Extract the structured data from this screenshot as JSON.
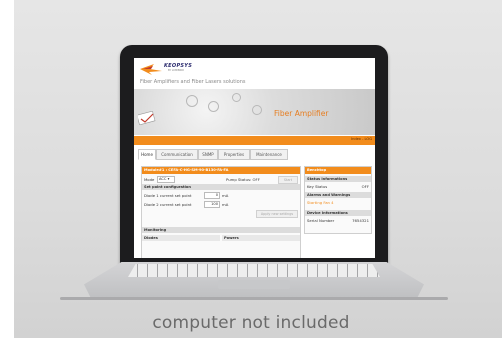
{
  "caption": "computer not included",
  "app": {
    "brand": "KEOPSYS",
    "brand_sub": "BY LUMIBIRD",
    "tagline": "Fiber Amplifiers and Fiber Lasers solutions",
    "banner_title": "Fiber Amplifier",
    "orange_bar_text": "Index - LOG"
  },
  "tabs": [
    {
      "label": "Home",
      "active": true
    },
    {
      "label": "Communication",
      "active": false
    },
    {
      "label": "SNMP",
      "active": false
    },
    {
      "label": "Properties",
      "active": false
    },
    {
      "label": "Maintenance",
      "active": false
    }
  ],
  "module": {
    "title": "Module#1 : CEFA-C-HG-SM-90-B130-FA-FA",
    "mode_label": "Mode",
    "mode_value": "ACC",
    "pump_status": "Pump Status: OFF",
    "start_label": "Start",
    "setpoint_section": "Set point configuration",
    "diode1_label": "Diode 1 current set point",
    "diode1_value": "0",
    "diode2_label": "Diode 2 current set point",
    "diode2_value": "100",
    "unit": "mA",
    "apply_label": "Apply new settings",
    "monitoring_section": "Monitoring",
    "col_diodes": "Diodes",
    "col_powers": "Powers"
  },
  "benchtop": {
    "title": "Benchtop",
    "status_section": "Status informations",
    "key_status_label": "Key Status",
    "key_status_value": "OFF",
    "alarms_section": "Alarms and Warnings",
    "alarm_item": "Starting Fan 4",
    "device_section": "Device Informations",
    "serial_label": "Serial Number",
    "serial_value": "7654321"
  }
}
